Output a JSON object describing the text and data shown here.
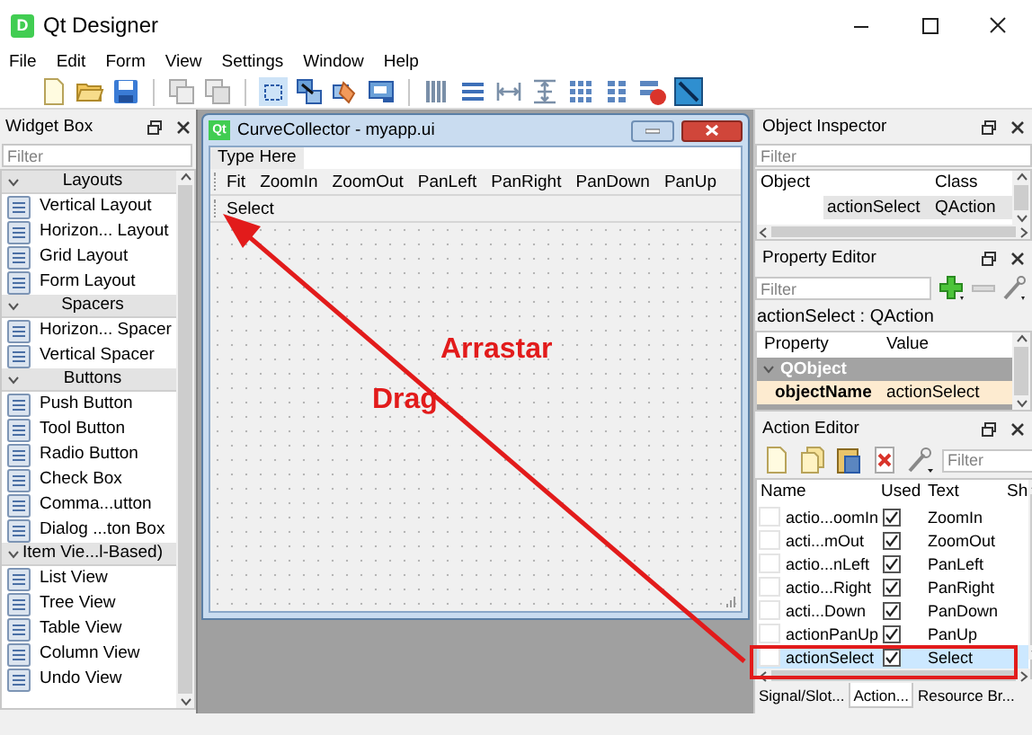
{
  "window": {
    "title": "Qt Designer",
    "logo": "D"
  },
  "menu": [
    "File",
    "Edit",
    "Form",
    "View",
    "Settings",
    "Window",
    "Help"
  ],
  "widget_box": {
    "title": "Widget Box",
    "filter_placeholder": "Filter",
    "sections": [
      {
        "title": "Layouts",
        "expanded": true,
        "items": [
          "Vertical Layout",
          "Horizon... Layout",
          "Grid Layout",
          "Form Layout"
        ]
      },
      {
        "title": "Spacers",
        "expanded": true,
        "items": [
          "Horizon... Spacer",
          "Vertical Spacer"
        ]
      },
      {
        "title": "Buttons",
        "expanded": true,
        "items": [
          "Push Button",
          "Tool Button",
          "Radio Button",
          "Check Box",
          "Comma...utton",
          "Dialog ...ton Box"
        ]
      },
      {
        "title": "Item Vie...l-Based)",
        "expanded": true,
        "items": [
          "List View",
          "Tree View",
          "Table View",
          "Column View",
          "Undo View"
        ]
      }
    ]
  },
  "form": {
    "title": "CurveCollector - myapp.ui",
    "logo": "Qt",
    "menu_placeholder": "Type Here",
    "toolbars": [
      [
        "Fit",
        "ZoomIn",
        "ZoomOut",
        "PanLeft",
        "PanRight",
        "PanDown",
        "PanUp"
      ],
      [
        "Select"
      ]
    ]
  },
  "object_inspector": {
    "title": "Object Inspector",
    "filter_placeholder": "Filter",
    "columns": [
      "Object",
      "Class"
    ],
    "rows": [
      {
        "object": "actionSelect",
        "class": "QAction",
        "selected": true
      }
    ]
  },
  "property_editor": {
    "title": "Property Editor",
    "filter_placeholder": "Filter",
    "object_label": "actionSelect : QAction",
    "columns": [
      "Property",
      "Value"
    ],
    "rows": [
      {
        "kind": "group",
        "name": "QObject",
        "expanded": true
      },
      {
        "kind": "property",
        "name": "objectName",
        "value": "actionSelect"
      }
    ]
  },
  "action_editor": {
    "title": "Action Editor",
    "filter_placeholder": "Filter",
    "columns": [
      "Name",
      "Used",
      "Text",
      "Sh"
    ],
    "rows": [
      {
        "name": "actio...oomIn",
        "used": true,
        "text": "ZoomIn",
        "selected": false
      },
      {
        "name": "acti...mOut",
        "used": true,
        "text": "ZoomOut",
        "selected": false
      },
      {
        "name": "actio...nLeft",
        "used": true,
        "text": "PanLeft",
        "selected": false
      },
      {
        "name": "actio...Right",
        "used": true,
        "text": "PanRight",
        "selected": false
      },
      {
        "name": "acti...Down",
        "used": true,
        "text": "PanDown",
        "selected": false
      },
      {
        "name": "actionPanUp",
        "used": true,
        "text": "PanUp",
        "selected": false
      },
      {
        "name": "actionSelect",
        "used": true,
        "text": "Select",
        "selected": true
      }
    ]
  },
  "dock_tabs": [
    {
      "label": "Signal/Slot...",
      "selected": false
    },
    {
      "label": "Action...",
      "selected": true
    },
    {
      "label": "Resource Br...",
      "selected": false
    }
  ],
  "annotations": [
    "Arrastar",
    "Drag"
  ]
}
